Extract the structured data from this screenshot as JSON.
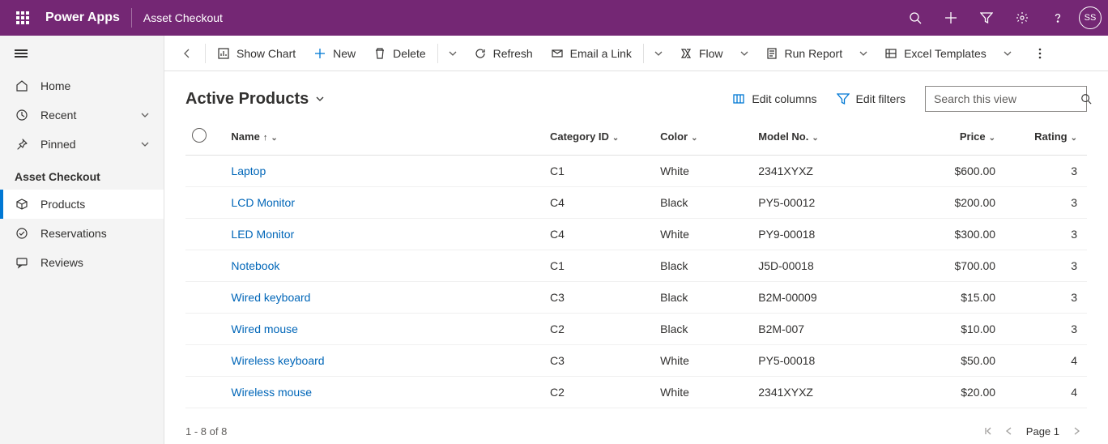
{
  "header": {
    "app_name": "Power Apps",
    "page_name": "Asset Checkout",
    "avatar": "SS"
  },
  "sidebar": {
    "home": "Home",
    "recent": "Recent",
    "pinned": "Pinned",
    "section": "Asset Checkout",
    "items": [
      {
        "label": "Products"
      },
      {
        "label": "Reservations"
      },
      {
        "label": "Reviews"
      }
    ]
  },
  "cmdbar": {
    "show_chart": "Show Chart",
    "new": "New",
    "delete": "Delete",
    "refresh": "Refresh",
    "email_link": "Email a Link",
    "flow": "Flow",
    "run_report": "Run Report",
    "excel_templates": "Excel Templates"
  },
  "view": {
    "title": "Active Products",
    "edit_columns": "Edit columns",
    "edit_filters": "Edit filters",
    "search_placeholder": "Search this view"
  },
  "table": {
    "columns": {
      "name": "Name",
      "category": "Category ID",
      "color": "Color",
      "model": "Model No.",
      "price": "Price",
      "rating": "Rating"
    },
    "rows": [
      {
        "name": "Laptop",
        "category": "C1",
        "color": "White",
        "model": "2341XYXZ",
        "price": "$600.00",
        "rating": "3"
      },
      {
        "name": "LCD Monitor",
        "category": "C4",
        "color": "Black",
        "model": "PY5-00012",
        "price": "$200.00",
        "rating": "3"
      },
      {
        "name": "LED Monitor",
        "category": "C4",
        "color": "White",
        "model": "PY9-00018",
        "price": "$300.00",
        "rating": "3"
      },
      {
        "name": "Notebook",
        "category": "C1",
        "color": "Black",
        "model": "J5D-00018",
        "price": "$700.00",
        "rating": "3"
      },
      {
        "name": "Wired keyboard",
        "category": "C3",
        "color": "Black",
        "model": "B2M-00009",
        "price": "$15.00",
        "rating": "3"
      },
      {
        "name": "Wired mouse",
        "category": "C2",
        "color": "Black",
        "model": "B2M-007",
        "price": "$10.00",
        "rating": "3"
      },
      {
        "name": "Wireless keyboard",
        "category": "C3",
        "color": "White",
        "model": "PY5-00018",
        "price": "$50.00",
        "rating": "4"
      },
      {
        "name": "Wireless mouse",
        "category": "C2",
        "color": "White",
        "model": "2341XYXZ",
        "price": "$20.00",
        "rating": "4"
      }
    ]
  },
  "footer": {
    "range": "1 - 8 of 8",
    "page": "Page 1"
  }
}
